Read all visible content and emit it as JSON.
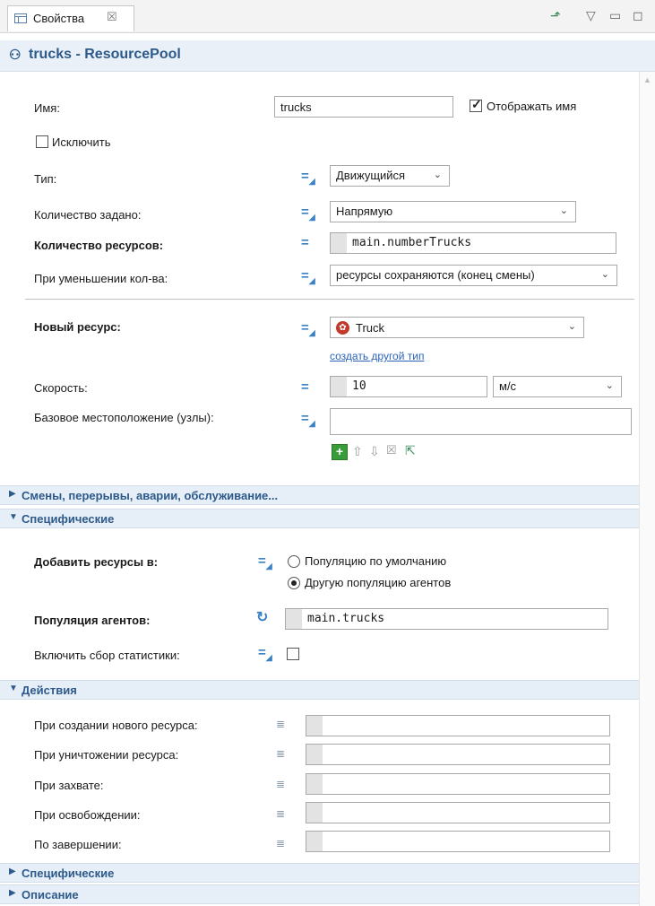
{
  "tab": {
    "label": "Свойства",
    "close": "☒"
  },
  "header": {
    "title": "trucks - ResourcePool"
  },
  "fields": {
    "name_label": "Имя:",
    "name_value": "trucks",
    "show_name_label": "Отображать имя",
    "show_name_checked": true,
    "exclude_label": "Исключить",
    "type_label": "Тип:",
    "type_value": "Движущийся",
    "count_mode_label": "Количество задано:",
    "count_mode_value": "Напрямую",
    "resource_count_label": "Количество ресурсов:",
    "resource_count_value": "main.numberTrucks",
    "on_decrease_label": "При уменьшении кол-ва:",
    "on_decrease_value": "ресурсы сохраняются (конец смены)",
    "new_resource_label": "Новый ресурс:",
    "new_resource_value": "Truck",
    "create_type_link": "создать другой тип",
    "speed_label": "Скорость:",
    "speed_value": "10",
    "speed_unit": "м/с",
    "home_label": "Базовое местоположение (узлы):"
  },
  "sections": {
    "shifts": "Смены, перерывы, аварии, обслуживание...",
    "specific": "Специфические",
    "actions": "Действия",
    "specific2": "Специфические",
    "description": "Описание"
  },
  "specific": {
    "add_to_label": "Добавить ресурсы в:",
    "radio_default": "Популяцию по умолчанию",
    "radio_other": "Другую популяцию агентов",
    "selected": "other",
    "population_label": "Популяция агентов:",
    "population_value": "main.trucks",
    "stats_label": "Включить сбор статистики:"
  },
  "actions": {
    "on_create": "При создании нового ресурса:",
    "on_destroy": "При уничтожении ресурса:",
    "on_seize": "При захвате:",
    "on_release": "При освобождении:",
    "on_finish": "По завершении:"
  },
  "colors": {
    "accent": "#2d5a8a",
    "section_bg": "#e6eef7",
    "link": "#2a63b8"
  }
}
